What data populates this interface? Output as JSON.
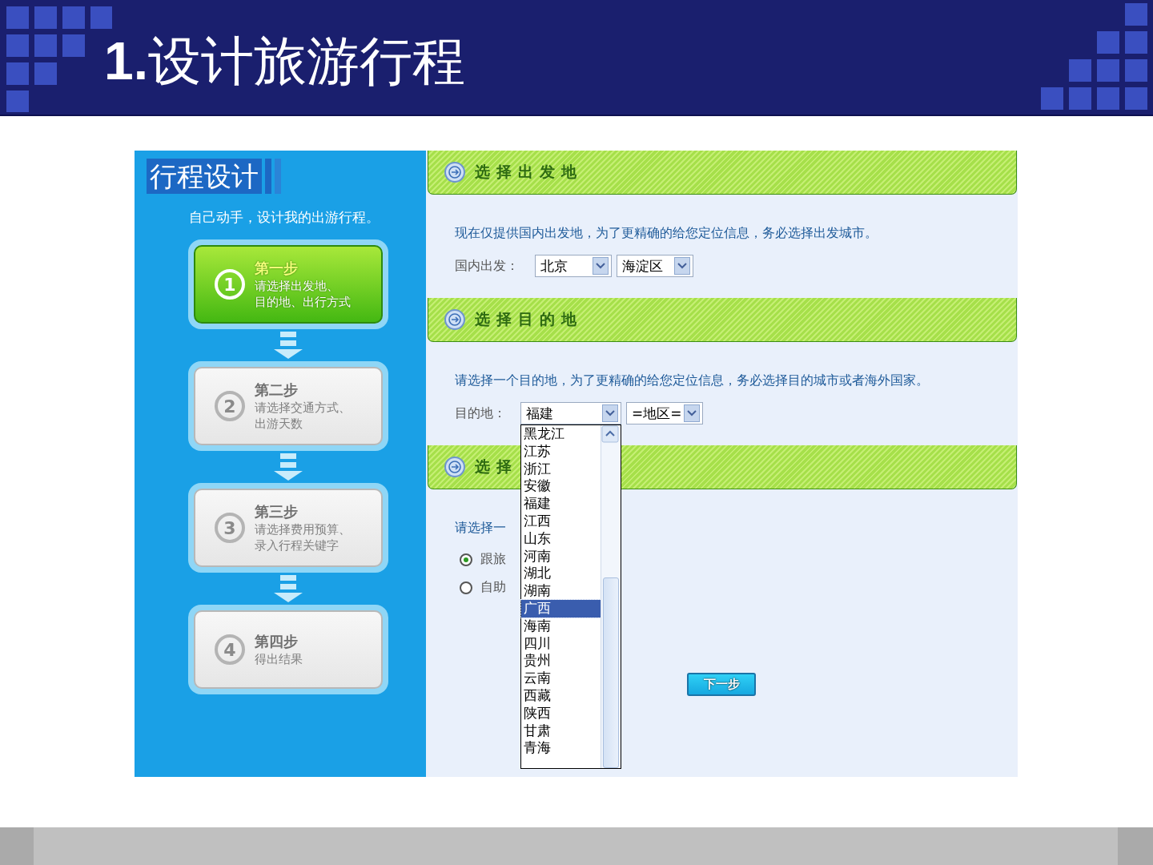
{
  "slide": {
    "title_number": "1.",
    "title": "设计旅游行程"
  },
  "sidebar": {
    "title": "行程设计",
    "subtitle": "自己动手，设计我的出游行程。",
    "steps": [
      {
        "number": "1",
        "title": "第一步",
        "lines": [
          "请选择出发地、",
          "目的地、出行方式"
        ],
        "selected": true
      },
      {
        "number": "2",
        "title": "第二步",
        "lines": [
          "请选择交通方式、",
          "出游天数"
        ],
        "selected": false
      },
      {
        "number": "3",
        "title": "第三步",
        "lines": [
          "请选择费用预算、",
          "录入行程关键字"
        ],
        "selected": false
      },
      {
        "number": "4",
        "title": "第四步",
        "lines": [
          "得出结果"
        ],
        "selected": false
      }
    ]
  },
  "departure": {
    "heading": "选择出发地",
    "note": "现在仅提供国内出发地，为了更精确的给您定位信息，务必选择出发城市。",
    "label": "国内出发：",
    "selects": [
      {
        "value": "北京"
      },
      {
        "value": "海淀区"
      }
    ]
  },
  "destination": {
    "heading": "选择目的地",
    "note": "请选择一个目的地，为了更精确的给您定位信息，务必选择目的城市或者海外国家。",
    "label": "目的地：",
    "selects": [
      {
        "value": "福建"
      },
      {
        "value": "=地区="
      }
    ],
    "dropdown": {
      "options": [
        {
          "label": "黑龙江",
          "selected": false
        },
        {
          "label": "江苏",
          "selected": false
        },
        {
          "label": "浙江",
          "selected": false
        },
        {
          "label": "安徽",
          "selected": false
        },
        {
          "label": "福建",
          "selected": false
        },
        {
          "label": "江西",
          "selected": false
        },
        {
          "label": "山东",
          "selected": false
        },
        {
          "label": "河南",
          "selected": false
        },
        {
          "label": "湖北",
          "selected": false
        },
        {
          "label": "湖南",
          "selected": false
        },
        {
          "label": "广西",
          "selected": true
        },
        {
          "label": "海南",
          "selected": false
        },
        {
          "label": "四川",
          "selected": false
        },
        {
          "label": "贵州",
          "selected": false
        },
        {
          "label": "云南",
          "selected": false
        },
        {
          "label": "西藏",
          "selected": false
        },
        {
          "label": "陕西",
          "selected": false
        },
        {
          "label": "甘肃",
          "selected": false
        },
        {
          "label": "青海",
          "selected": false
        }
      ]
    }
  },
  "travel_mode": {
    "heading": "选择",
    "note": "请选择一",
    "options": [
      {
        "label": "跟旅",
        "selected": true
      },
      {
        "label": "自助",
        "selected": false
      }
    ]
  },
  "next_button": "下一步"
}
